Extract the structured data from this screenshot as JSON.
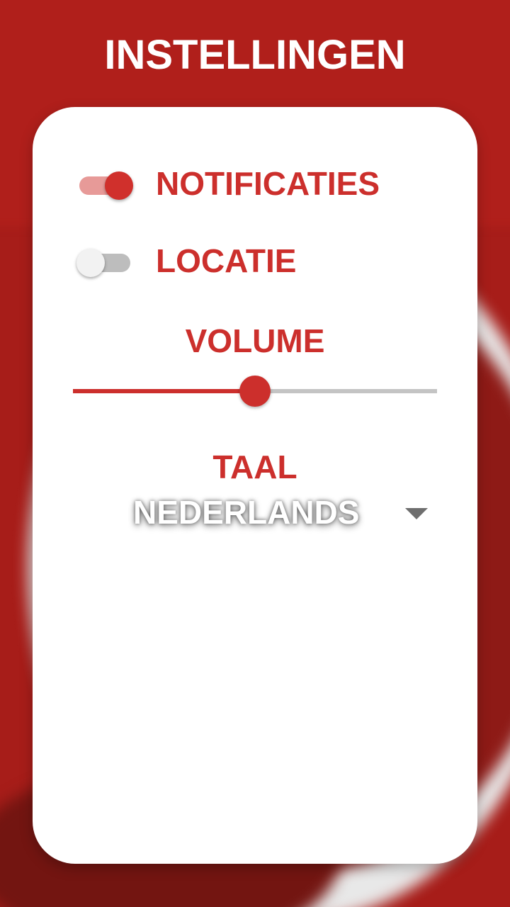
{
  "header": {
    "title": "INSTELLINGEN"
  },
  "settings": {
    "notifications": {
      "label": "NOTIFICATIES",
      "enabled": true
    },
    "location": {
      "label": "LOCATIE",
      "enabled": false
    },
    "volume": {
      "label": "VOLUME",
      "value": 0.5
    },
    "language": {
      "label": "TAAL",
      "selected": "NEDERLANDS"
    }
  },
  "colors": {
    "accent": "#cc2f2c",
    "background": "#a71d19",
    "card": "#ffffff"
  },
  "icons": {
    "dropdown": "chevron-down-icon"
  }
}
